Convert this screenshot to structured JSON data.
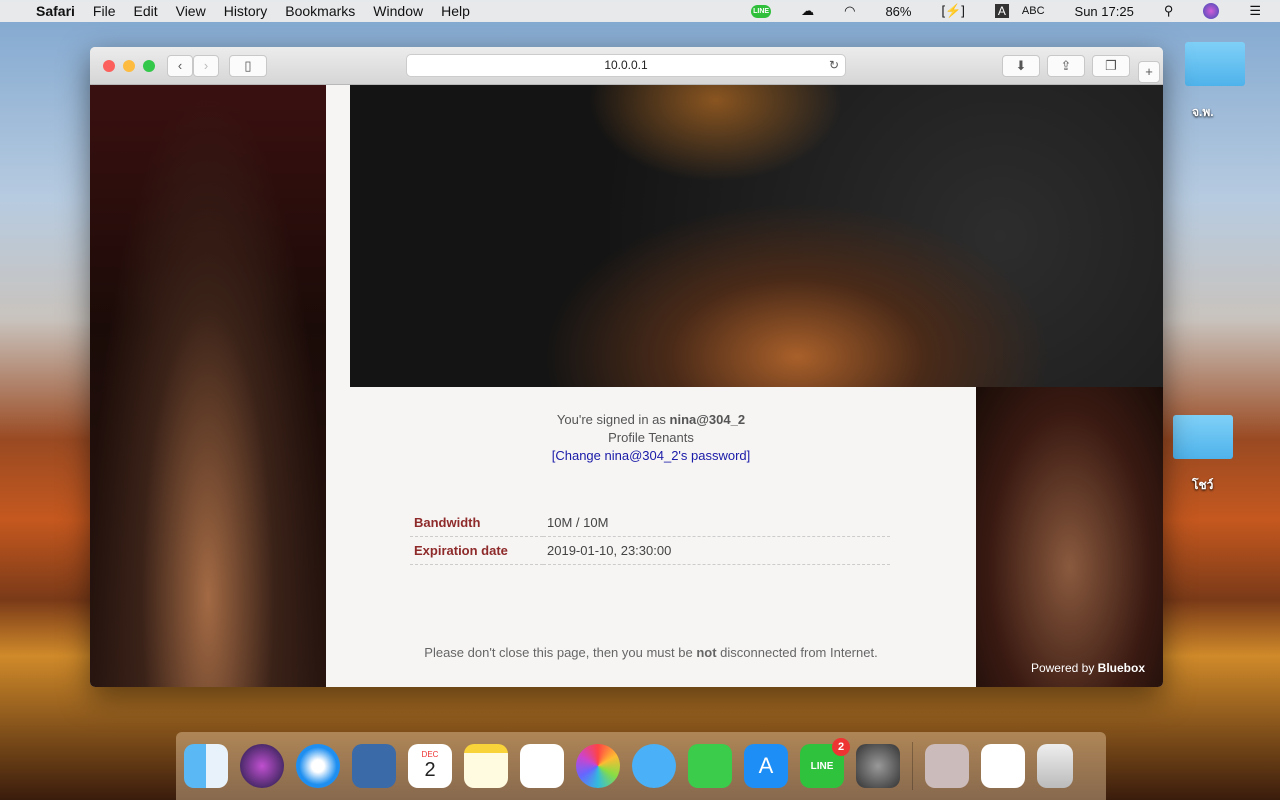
{
  "menubar": {
    "apple": "",
    "app": "Safari",
    "items": [
      "File",
      "Edit",
      "View",
      "History",
      "Bookmarks",
      "Window",
      "Help"
    ],
    "status": {
      "line": "LINE",
      "battery": "86%",
      "input_letter": "A",
      "input": "ABC",
      "clock": "Sun 17:25"
    }
  },
  "browser": {
    "url": "10.0.0.1"
  },
  "page": {
    "signed_prefix": "You're signed in as ",
    "username": "nina@304_2",
    "profile": "Profile Tenants",
    "change_password": "[Change nina@304_2's password]",
    "rows": [
      {
        "label": "Bandwidth",
        "value": "10M / 10M"
      },
      {
        "label": "Expiration date",
        "value": "2019-01-10, 23:30:00"
      }
    ],
    "note_pre": "Please don't close this page, then you must be ",
    "note_bold": "not",
    "note_post": " disconnected from Internet.",
    "powered_pre": "Powered by ",
    "powered_brand": "Bluebox"
  },
  "desktop": {
    "folders": [
      "จ.พ.",
      "โชว์"
    ]
  },
  "dock": {
    "calendar_month": "DEC",
    "calendar_day": "2",
    "line_badge": "2",
    "line_label": "LINE"
  }
}
